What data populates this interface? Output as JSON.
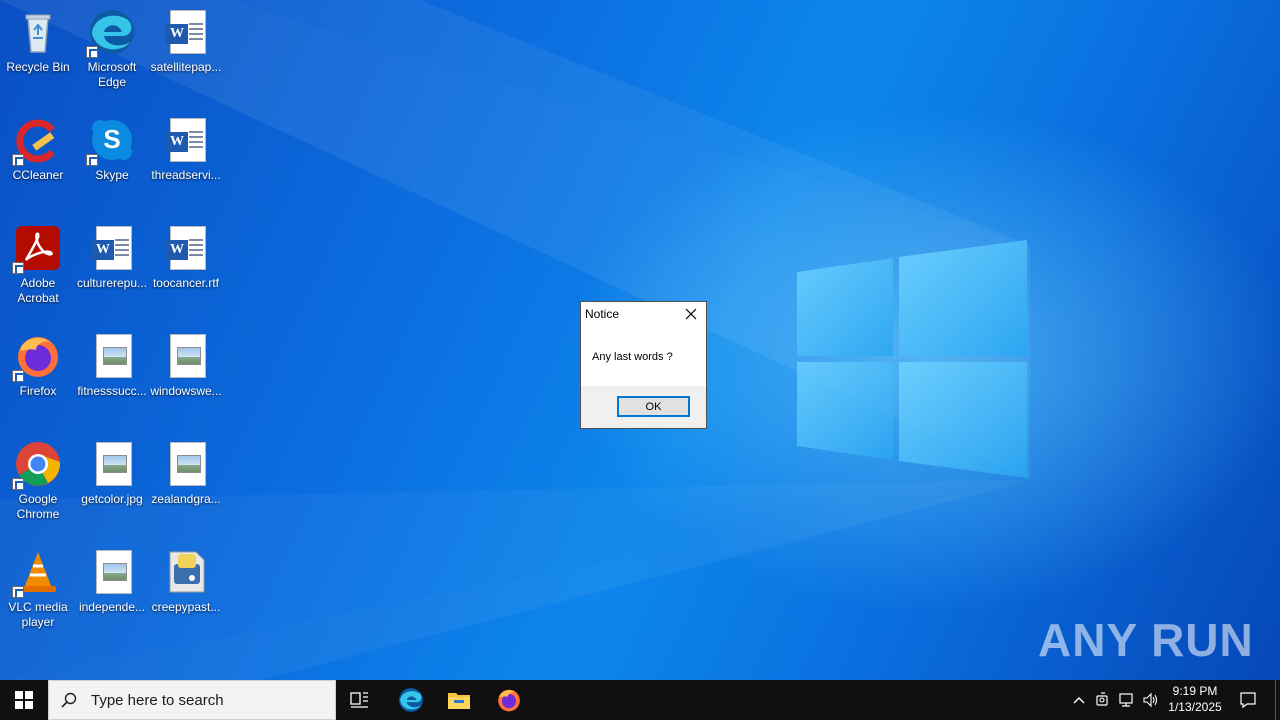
{
  "desktop": {
    "icons": [
      {
        "label": "Recycle Bin",
        "icon": "recycle-bin-icon"
      },
      {
        "label": "Microsoft Edge",
        "icon": "edge-icon"
      },
      {
        "label": "satellitepap...",
        "icon": "word-document-icon"
      },
      {
        "label": "CCleaner",
        "icon": "ccleaner-icon"
      },
      {
        "label": "Skype",
        "icon": "skype-icon"
      },
      {
        "label": "threadservi...",
        "icon": "word-document-icon"
      },
      {
        "label": "Adobe Acrobat",
        "icon": "acrobat-icon"
      },
      {
        "label": "culturerepu...",
        "icon": "word-document-icon"
      },
      {
        "label": "toocancer.rtf",
        "icon": "word-document-icon"
      },
      {
        "label": "Firefox",
        "icon": "firefox-icon"
      },
      {
        "label": "fitnesssucc...",
        "icon": "image-file-icon"
      },
      {
        "label": "windowswe...",
        "icon": "image-file-icon"
      },
      {
        "label": "Google Chrome",
        "icon": "chrome-icon"
      },
      {
        "label": "getcolor.jpg",
        "icon": "image-file-icon"
      },
      {
        "label": "zealandgra...",
        "icon": "image-file-icon"
      },
      {
        "label": "VLC media player",
        "icon": "vlc-icon"
      },
      {
        "label": "independe...",
        "icon": "image-file-icon"
      },
      {
        "label": "creepypast...",
        "icon": "python-file-icon"
      }
    ]
  },
  "dialog": {
    "title": "Notice",
    "message": "Any last words ?",
    "ok_label": "OK"
  },
  "watermark": {
    "text": "ANY RUN"
  },
  "taskbar": {
    "search_placeholder": "Type here to search",
    "pinned": [
      "task-view-icon",
      "edge-icon",
      "file-explorer-icon",
      "firefox-icon"
    ],
    "clock_time": "9:19 PM",
    "clock_date": "1/13/2025"
  },
  "colors": {
    "accent": "#0078d7",
    "taskbar": "#101010",
    "desktop": "#0a6fd8"
  }
}
